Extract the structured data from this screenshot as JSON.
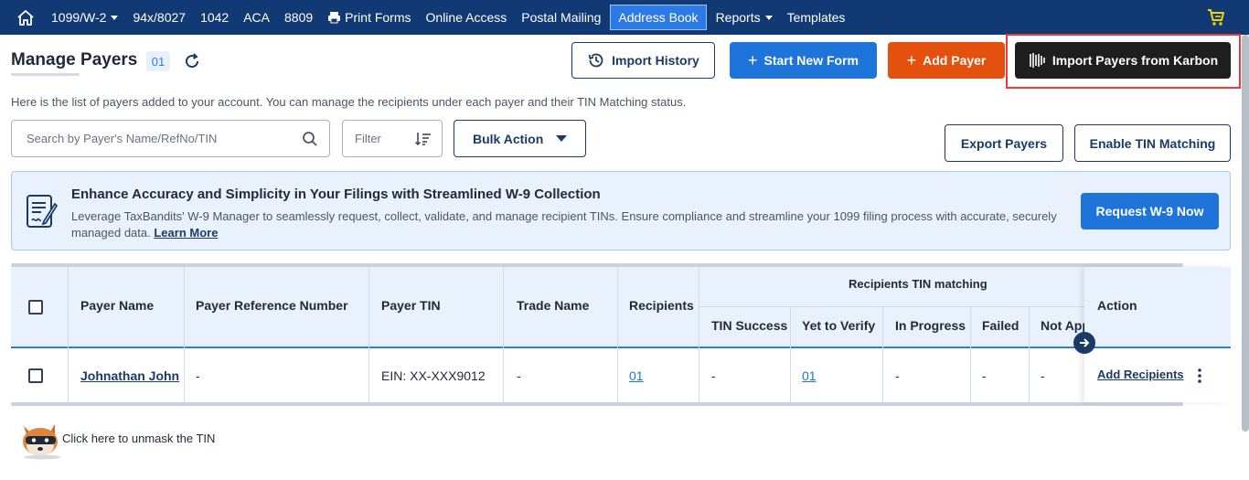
{
  "nav": {
    "items": [
      {
        "label": "1099/W-2",
        "dropdown": true
      },
      {
        "label": "94x/8027",
        "dropdown": false
      },
      {
        "label": "1042",
        "dropdown": false
      },
      {
        "label": "ACA",
        "dropdown": false
      },
      {
        "label": "8809",
        "dropdown": false
      },
      {
        "label": "Print Forms",
        "dropdown": false
      },
      {
        "label": "Online Access",
        "dropdown": false
      },
      {
        "label": "Postal Mailing",
        "dropdown": false
      },
      {
        "label": "Address Book",
        "dropdown": false,
        "active": true
      },
      {
        "label": "Reports",
        "dropdown": true
      },
      {
        "label": "Templates",
        "dropdown": false
      }
    ]
  },
  "header": {
    "title": "Manage Payers",
    "count": "01",
    "import_history": "Import History",
    "start_new_form": "Start New Form",
    "add_payer": "Add Payer",
    "import_karbon": "Import Payers from Karbon"
  },
  "description": "Here is the list of payers added to your account. You can manage the recipients under each payer and their TIN Matching status.",
  "toolbar": {
    "search_placeholder": "Search by Payer's Name/RefNo/TIN",
    "filter": "Filter",
    "bulk_action": "Bulk Action",
    "export_payers": "Export Payers",
    "enable_tin": "Enable TIN Matching"
  },
  "banner": {
    "title": "Enhance Accuracy and Simplicity in Your Filings with Streamlined W-9 Collection",
    "text": "Leverage TaxBandits' W-9 Manager to seamlessly request, collect, validate, and manage recipient TINs. Ensure compliance and streamline your 1099 filing process with accurate, securely managed data.",
    "learn_more": "Learn More",
    "button": "Request W-9 Now"
  },
  "table": {
    "headers": {
      "payer_name": "Payer Name",
      "ref_no": "Payer Reference Number",
      "tin": "Payer TIN",
      "trade_name": "Trade Name",
      "recipients": "Recipients",
      "tin_group": "Recipients TIN matching",
      "tin_success": "TIN Success",
      "yet_to_verify": "Yet to Verify",
      "in_progress": "In Progress",
      "failed": "Failed",
      "not_applicable": "Not App",
      "action": "Action"
    },
    "rows": [
      {
        "payer_name": "Johnathan John",
        "ref_no": "-",
        "tin": "EIN: XX-XXX9012",
        "trade_name": "-",
        "recipients": "01",
        "tin_success": "-",
        "yet_to_verify": "01",
        "in_progress": "-",
        "failed": "-",
        "not_applicable": "-",
        "action": "Add Recipients"
      }
    ]
  },
  "footer": {
    "unmask": "Click here to unmask the TIN"
  },
  "colors": {
    "nav_bg": "#113a74",
    "primary": "#1e74d9",
    "orange": "#e4510e",
    "dark": "#1e1e1e",
    "highlight": "#e53d3d",
    "cart": "#f4d400"
  },
  "icons": [
    "home-icon",
    "caret-down-icon",
    "printer-icon",
    "cart-icon",
    "refresh-icon",
    "history-icon",
    "plus-icon",
    "karbon-logo-icon",
    "search-icon",
    "sort-icon",
    "w9-document-icon",
    "arrow-right-icon",
    "kebab-icon",
    "mascot-icon"
  ]
}
